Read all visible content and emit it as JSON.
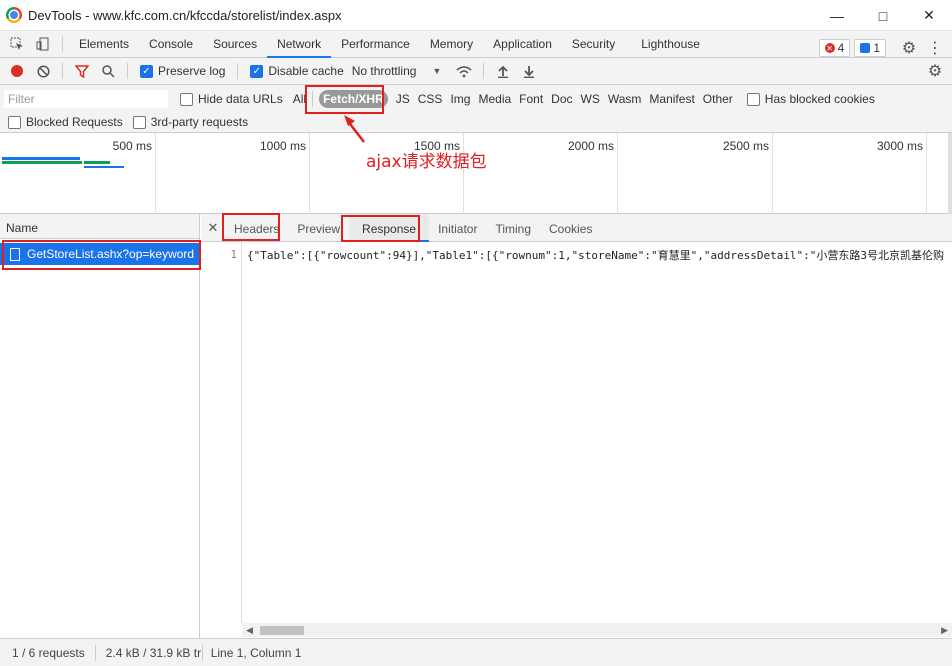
{
  "window": {
    "title": "DevTools - www.kfc.com.cn/kfccda/storelist/index.aspx"
  },
  "tabs": [
    "Elements",
    "Console",
    "Sources",
    "Network",
    "Performance",
    "Memory",
    "Application",
    "Security",
    "Lighthouse"
  ],
  "active_tab": "Network",
  "badges": {
    "errors": "4",
    "messages": "1"
  },
  "toolbar": {
    "preserve_log": "Preserve log",
    "disable_cache": "Disable cache",
    "throttling": "No throttling"
  },
  "filter": {
    "placeholder": "Filter",
    "hide_data_urls": "Hide data URLs",
    "types": [
      "All",
      "Fetch/XHR",
      "JS",
      "CSS",
      "Img",
      "Media",
      "Font",
      "Doc",
      "WS",
      "Wasm",
      "Manifest",
      "Other"
    ],
    "active_type": "Fetch/XHR",
    "has_blocked_cookies": "Has blocked cookies",
    "blocked_requests": "Blocked Requests",
    "third_party": "3rd-party requests"
  },
  "timeline": {
    "ticks": [
      "500 ms",
      "1000 ms",
      "1500 ms",
      "2000 ms",
      "2500 ms",
      "3000 ms"
    ]
  },
  "requests": {
    "column": "Name",
    "items": [
      "GetStoreList.ashx?op=keyword"
    ]
  },
  "detail": {
    "tabs": [
      "Headers",
      "Preview",
      "Response",
      "Initiator",
      "Timing",
      "Cookies"
    ],
    "active": "Response",
    "line_number": "1",
    "response_text": "{\"Table\":[{\"rowcount\":94}],\"Table1\":[{\"rownum\":1,\"storeName\":\"育慧里\",\"addressDetail\":\"小营东路3号北京凯基伦购"
  },
  "status": {
    "requests": "1 / 6 requests",
    "transfer": "2.4 kB / 31.9 kB tr",
    "position": "Line 1, Column 1"
  },
  "annotation": {
    "label": "ajax请求数据包"
  },
  "colors": {
    "accent": "#1a73e8",
    "annotation": "#e02020"
  }
}
